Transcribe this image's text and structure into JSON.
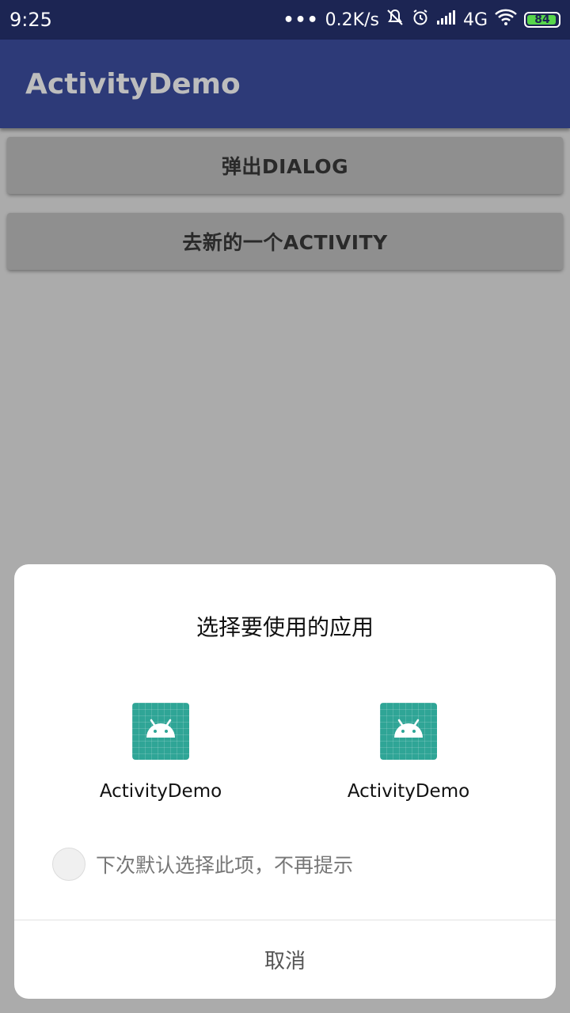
{
  "status_bar": {
    "time": "9:25",
    "more": "•••",
    "speed": "0.2K/s",
    "network": "4G",
    "battery": "84",
    "icons": [
      "bell-off-icon",
      "alarm-icon",
      "signal-icon",
      "wifi-icon",
      "battery-icon"
    ]
  },
  "app_bar": {
    "title": "ActivityDemo"
  },
  "buttons": {
    "popup_dialog": "弹出DIALOG",
    "new_activity": "去新的一个ACTIVITY"
  },
  "dialog": {
    "title": "选择要使用的应用",
    "apps": [
      {
        "label": "ActivityDemo",
        "icon": "android-icon"
      },
      {
        "label": "ActivityDemo",
        "icon": "android-icon"
      }
    ],
    "remember_label": "下次默认选择此项，不再提示",
    "cancel_label": "取消"
  },
  "colors": {
    "status_bar": "#1c2553",
    "app_bar": "#2d3a78",
    "app_icon": "#2fa596",
    "battery_fill": "#57d64b"
  }
}
